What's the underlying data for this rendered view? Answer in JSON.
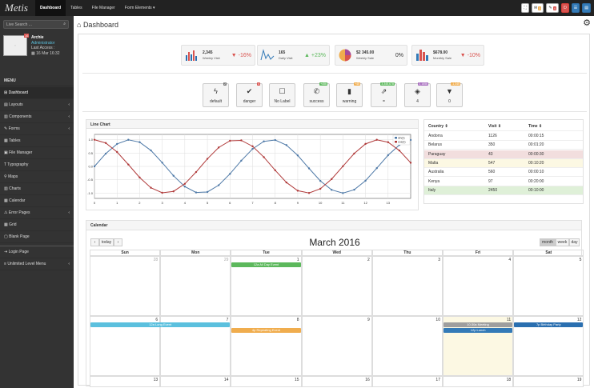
{
  "topbar": {
    "logo": "Metis",
    "nav": [
      "Dashboard",
      "Tables",
      "File Manager",
      "Form Elements ▾"
    ],
    "badges": [
      "3",
      "4",
      "5"
    ],
    "icons": [
      "fullscreen-icon",
      "envelope-icon",
      "comment-icon",
      "power-icon",
      "menu-icon",
      "toggle-icon"
    ]
  },
  "sidebar": {
    "search_placeholder": "Live Search ...",
    "user": {
      "name": "Archie",
      "role": "Administrator",
      "last_access": "Last Access :",
      "date": "16 Mar 16:32",
      "badge": "16"
    },
    "menu_header": "MENU",
    "items": [
      {
        "label": "Dashboard",
        "chev": false
      },
      {
        "label": "Layouts",
        "chev": true
      },
      {
        "label": "Components",
        "chev": true
      },
      {
        "label": "Forms",
        "chev": true
      },
      {
        "label": "Tables",
        "chev": false
      },
      {
        "label": "File Manager",
        "chev": false
      },
      {
        "label": "Typography",
        "chev": false
      },
      {
        "label": "Maps",
        "chev": false
      },
      {
        "label": "Charts",
        "chev": false
      },
      {
        "label": "Calendar",
        "chev": false
      },
      {
        "label": "Error Pages",
        "chev": true
      },
      {
        "label": "Grid",
        "chev": false
      },
      {
        "label": "Blank Page",
        "chev": false
      }
    ],
    "items2": [
      {
        "label": "Login Page",
        "chev": false
      },
      {
        "label": "Unlimited Level Menu",
        "chev": true
      }
    ]
  },
  "header": {
    "title": "Dashboard"
  },
  "stats": [
    {
      "value": "2,345",
      "label": "Weekly Visit",
      "pct": "-16%",
      "dir": "down"
    },
    {
      "value": "165",
      "label": "Daily Visit",
      "pct": "+23%",
      "dir": "up"
    },
    {
      "value": "$2 345.00",
      "label": "Weekly Sale",
      "pct": "0%",
      "dir": "none"
    },
    {
      "value": "$678.00",
      "label": "Monthly Sale",
      "pct": "-10%",
      "dir": "down"
    }
  ],
  "quick": [
    {
      "label": "default",
      "badge": "2",
      "badge_color": "#777"
    },
    {
      "label": "danger",
      "badge": "4",
      "badge_color": "#d9534f"
    },
    {
      "label": "No Label",
      "badge": "",
      "badge_color": ""
    },
    {
      "label": "success",
      "badge": "+456",
      "badge_color": "#5cb85c"
    },
    {
      "label": "warning",
      "badge": "+45",
      "badge_color": "#f0ad4e"
    },
    {
      "label": "=",
      "badge": "3,345,678",
      "badge_color": "#5cb85c"
    },
    {
      "label": "4",
      "badge": "2,1656",
      "badge_color": "#a66bbe"
    },
    {
      "label": "0",
      "badge": "-1,345",
      "badge_color": "#f0ad4e"
    }
  ],
  "chart_data": {
    "type": "line",
    "title": "Line Chart",
    "x": [
      0,
      0.5,
      1,
      1.5,
      2,
      2.5,
      3,
      3.5,
      4,
      4.5,
      5,
      5.5,
      6,
      6.5,
      7,
      7.5,
      8,
      8.5,
      9,
      9.5,
      10,
      10.5,
      11,
      11.5,
      12,
      12.5,
      13,
      13.5,
      14
    ],
    "xticks": [
      "0",
      "1",
      "2",
      "3",
      "4",
      "5",
      "6",
      "7",
      "8",
      "9",
      "10",
      "11",
      "12",
      "13"
    ],
    "ylim": [
      -1.2,
      1.2
    ],
    "yticks": [
      "1.0",
      "0.5",
      "0.0",
      "-0.5",
      "-1.0"
    ],
    "series": [
      {
        "name": "sin(x)",
        "color": "#4e79a7"
      },
      {
        "name": "cos(x)",
        "color": "#b03a3a"
      }
    ],
    "legend": "top-right",
    "grid": true
  },
  "table": {
    "headers": [
      "Country ⇕",
      "Visit ⇕",
      "Time ⇕"
    ],
    "rows": [
      {
        "country": "Andorra",
        "visit": "1126",
        "time": "00:00:15",
        "bg": "#ffffff"
      },
      {
        "country": "Belarus",
        "visit": "350",
        "time": "00:01:20",
        "bg": "#ffffff"
      },
      {
        "country": "Paraguay",
        "visit": "43",
        "time": "00:00:30",
        "bg": "#f2dede"
      },
      {
        "country": "Malta",
        "visit": "547",
        "time": "00:10:20",
        "bg": "#fcf8e3"
      },
      {
        "country": "Australia",
        "visit": "560",
        "time": "00:00:10",
        "bg": "#ffffff"
      },
      {
        "country": "Kenya",
        "visit": "97",
        "time": "00:20:00",
        "bg": "#ffffff"
      },
      {
        "country": "Italy",
        "visit": "2450",
        "time": "00:10:00",
        "bg": "#dff0d8"
      }
    ]
  },
  "calendar": {
    "header": "Calendar",
    "title": "March 2016",
    "today_btn": "today",
    "prev": "‹",
    "next": "›",
    "views": [
      "month",
      "week",
      "day"
    ],
    "dow": [
      "Sun",
      "Mon",
      "Tue",
      "Wed",
      "Thu",
      "Fri",
      "Sat"
    ],
    "weeks": [
      [
        "28",
        "29",
        "1",
        "2",
        "3",
        "4",
        "5"
      ],
      [
        "6",
        "7",
        "8",
        "9",
        "10",
        "11",
        "12"
      ],
      [
        "13",
        "14",
        "15",
        "16",
        "17",
        "18",
        "19"
      ]
    ],
    "events": {
      "all_day": "12a All Day Event",
      "long": "12a Long Event",
      "repeating": "4p Repeating Event",
      "meeting": "10:30a Meeting",
      "lunch": "12p Lunch",
      "birthday": "7p Birthday Party"
    }
  }
}
